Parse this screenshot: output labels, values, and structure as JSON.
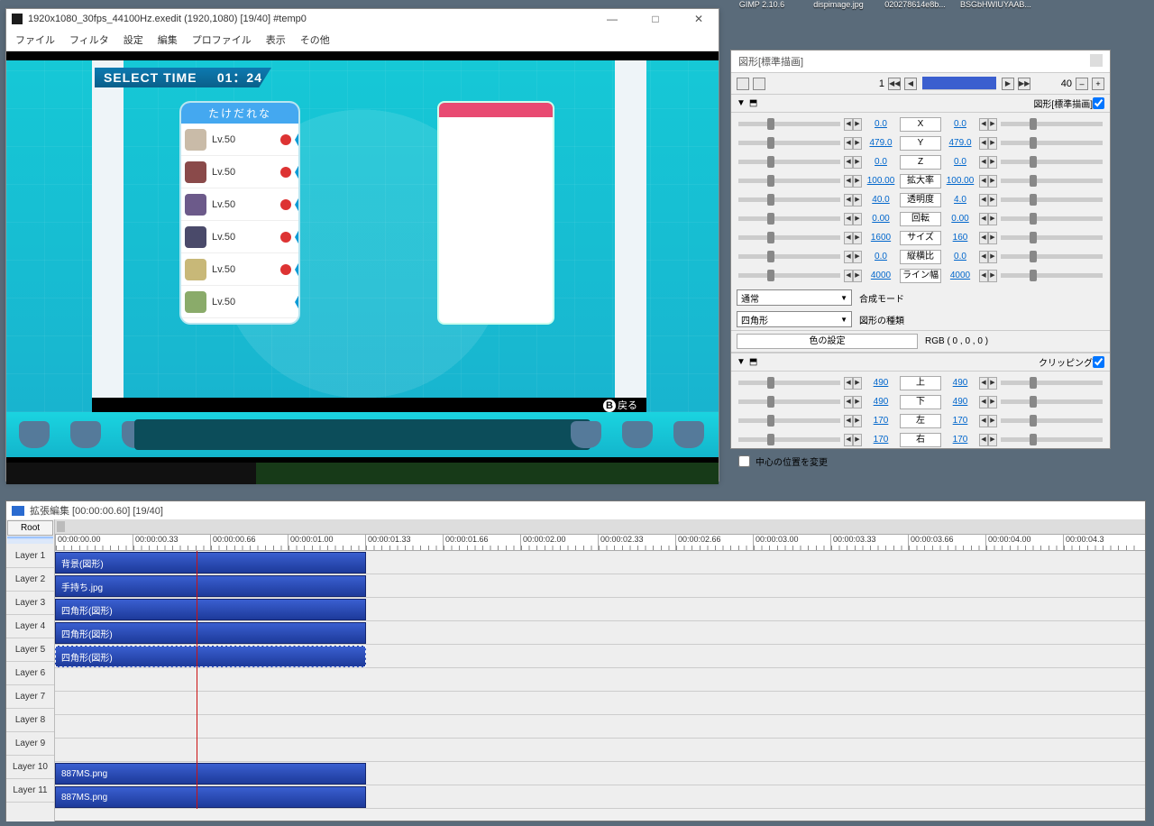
{
  "desktop_icons": [
    {
      "label": "GIMP 2.10.6"
    },
    {
      "label": "dispimage.jpg"
    },
    {
      "label": "020278614e8b..."
    },
    {
      "label": "BSGbHWIUYAAB..."
    }
  ],
  "preview": {
    "title": "1920x1080_30fps_44100Hz.exedit (1920,1080)  [19/40]  #temp0",
    "menu": [
      "ファイル",
      "フィルタ",
      "設定",
      "編集",
      "プロファイル",
      "表示",
      "その他"
    ],
    "select_time_label": "SELECT TIME",
    "select_time_value": "01：24",
    "trainer_name": "たけだれな",
    "party": [
      {
        "lv": "Lv.50"
      },
      {
        "lv": "Lv.50"
      },
      {
        "lv": "Lv.50"
      },
      {
        "lv": "Lv.50"
      },
      {
        "lv": "Lv.50"
      },
      {
        "lv": "Lv.50"
      }
    ],
    "back_label": "戻る",
    "back_btn": "B"
  },
  "prop": {
    "title": "図形[標準描画]",
    "frame_start": "1",
    "frame_end": "40",
    "section1": "図形[標準描画]",
    "rows": [
      {
        "vL": "0.0",
        "label": "X",
        "vR": "0.0"
      },
      {
        "vL": "479.0",
        "label": "Y",
        "vR": "479.0"
      },
      {
        "vL": "0.0",
        "label": "Z",
        "vR": "0.0"
      },
      {
        "vL": "100.00",
        "label": "拡大率",
        "vR": "100.00"
      },
      {
        "vL": "40.0",
        "label": "透明度",
        "vR": "4.0"
      },
      {
        "vL": "0.00",
        "label": "回転",
        "vR": "0.00"
      },
      {
        "vL": "1600",
        "label": "サイズ",
        "vR": "160"
      },
      {
        "vL": "0.0",
        "label": "縦横比",
        "vR": "0.0"
      },
      {
        "vL": "4000",
        "label": "ライン幅",
        "vR": "4000"
      }
    ],
    "blend_mode": "通常",
    "blend_label": "合成モード",
    "shape_type": "四角形",
    "shape_label": "図形の種類",
    "color_btn": "色の設定",
    "rgb": "RGB ( 0 , 0 , 0 )",
    "section2": "クリッピング",
    "clip_rows": [
      {
        "vL": "490",
        "label": "上",
        "vR": "490"
      },
      {
        "vL": "490",
        "label": "下",
        "vR": "490"
      },
      {
        "vL": "170",
        "label": "左",
        "vR": "170"
      },
      {
        "vL": "170",
        "label": "右",
        "vR": "170"
      }
    ],
    "center_checkbox": "中心の位置を変更"
  },
  "timeline": {
    "title": "拡張編集 [00:00:00.60] [19/40]",
    "root": "Root",
    "ticks": [
      "00:00:00.00",
      "00:00:00.33",
      "00:00:00.66",
      "00:00:01.00",
      "00:00:01.33",
      "00:00:01.66",
      "00:00:02.00",
      "00:00:02.33",
      "00:00:02.66",
      "00:00:03.00",
      "00:00:03.33",
      "00:00:03.66",
      "00:00:04.00",
      "00:00:04.3"
    ],
    "layers": [
      {
        "name": "Layer 1",
        "clip": "背景(図形)"
      },
      {
        "name": "Layer 2",
        "clip": "手持ち.jpg"
      },
      {
        "name": "Layer 3",
        "clip": "四角形(図形)"
      },
      {
        "name": "Layer 4",
        "clip": "四角形(図形)"
      },
      {
        "name": "Layer 5",
        "clip": "四角形(図形)",
        "selected": true
      },
      {
        "name": "Layer 6",
        "clip": null
      },
      {
        "name": "Layer 7",
        "clip": null
      },
      {
        "name": "Layer 8",
        "clip": null
      },
      {
        "name": "Layer 9",
        "clip": null
      },
      {
        "name": "Layer 10",
        "clip": "887MS.png"
      },
      {
        "name": "Layer 11",
        "clip": "887MS.png"
      }
    ]
  }
}
